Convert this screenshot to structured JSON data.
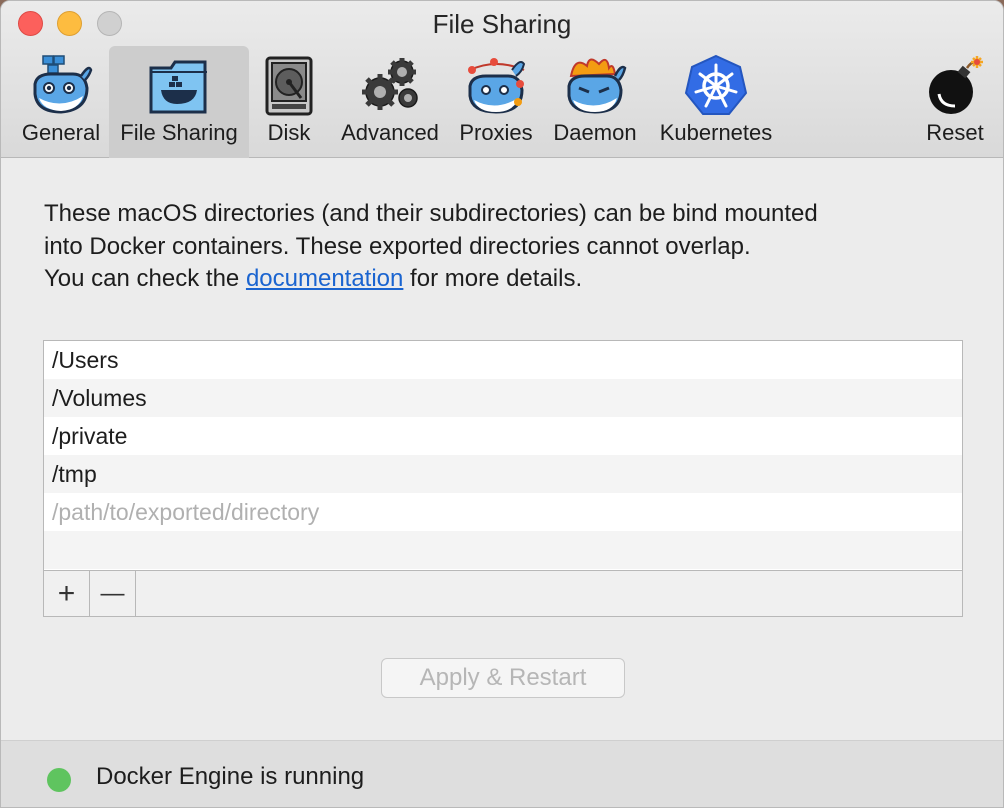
{
  "window": {
    "title": "File Sharing"
  },
  "tabs": [
    {
      "label": "General",
      "icon": "whale-general-icon"
    },
    {
      "label": "File Sharing",
      "icon": "folder-whale-icon",
      "selected": true
    },
    {
      "label": "Disk",
      "icon": "disk-drive-icon"
    },
    {
      "label": "Advanced",
      "icon": "gears-icon"
    },
    {
      "label": "Proxies",
      "icon": "whale-network-icon"
    },
    {
      "label": "Daemon",
      "icon": "whale-fire-icon"
    },
    {
      "label": "Kubernetes",
      "icon": "kubernetes-helm-icon"
    },
    {
      "label": "Reset",
      "icon": "bomb-icon"
    }
  ],
  "description": {
    "line1": "These macOS directories (and their subdirectories) can be bind mounted",
    "line2": "into Docker containers. These exported directories cannot overlap.",
    "line3_before": "You can check the ",
    "line3_link": "documentation",
    "line3_after": " for more details."
  },
  "directories": [
    "/Users",
    "/Volumes",
    "/private",
    "/tmp"
  ],
  "new_directory_placeholder": "/path/to/exported/directory",
  "list_buttons": {
    "add": "+",
    "remove": "—"
  },
  "apply_button": "Apply & Restart",
  "status": {
    "text": "Docker Engine is running",
    "color": "#5fc45f"
  }
}
